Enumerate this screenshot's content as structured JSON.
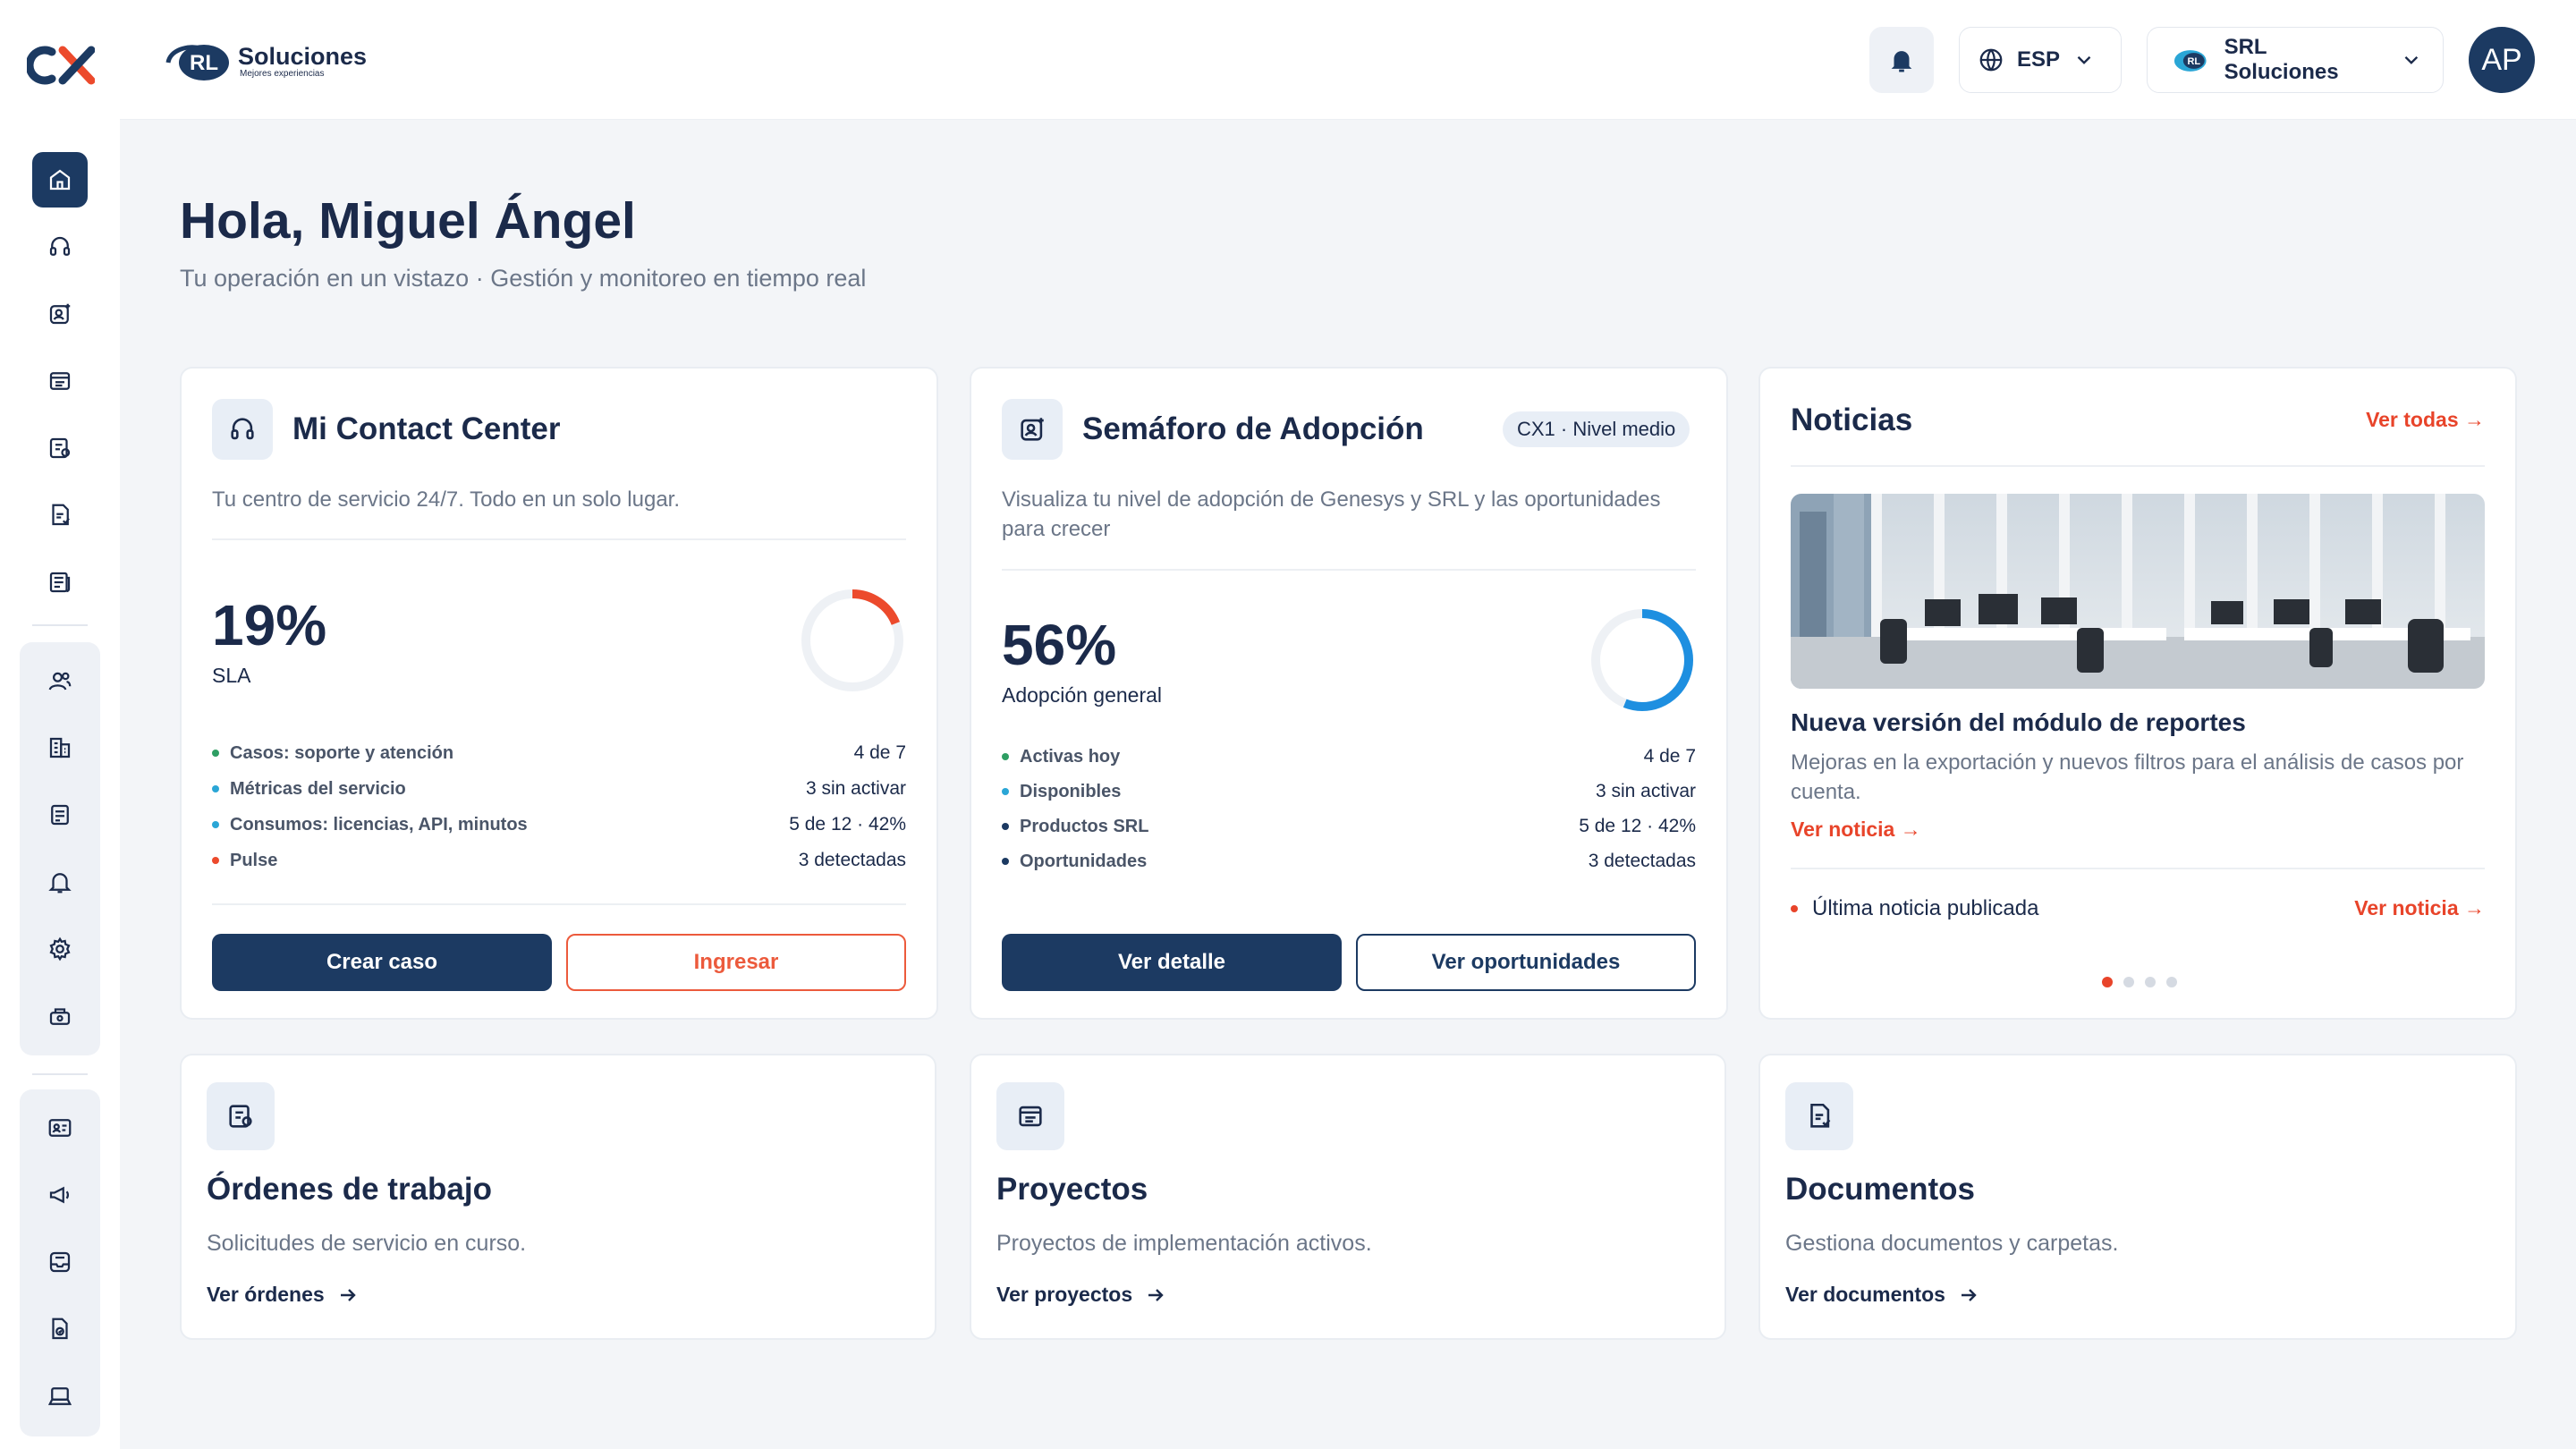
{
  "header": {
    "brand_name": "Soluciones",
    "brand_tag": "Mejores experiencias",
    "language": "ESP",
    "organization": "SRL Soluciones",
    "avatar_initials": "AP"
  },
  "greeting": {
    "title": "Hola, Miguel Ángel",
    "subtitle": "Tu operación en un vistazo · Gestión y monitoreo en tiempo real"
  },
  "contact_center": {
    "title": "Mi Contact Center",
    "description": "Tu centro de servicio 24/7. Todo en un solo lugar.",
    "big_value": "19%",
    "big_label": "SLA",
    "gauge_fraction": 0.19,
    "gauge_color": "#ec4a2c",
    "metrics": [
      {
        "label": "Casos: soporte y atención",
        "value": "4 de 7",
        "color": "#2e9e63"
      },
      {
        "label": "Métricas del servicio",
        "value": "3 sin activar",
        "color": "#2aa6d6"
      },
      {
        "label": "Consumos: licencias, API, minutos",
        "value": "5 de 12 · 42%",
        "color": "#2aa6d6"
      },
      {
        "label": "Pulse",
        "value": "3 detectadas",
        "color": "#ec4a2c"
      }
    ],
    "primary_button": "Crear caso",
    "secondary_button": "Ingresar"
  },
  "adoption": {
    "title": "Semáforo de Adopción",
    "badge": "CX1 · Nivel medio",
    "description": "Visualiza tu nivel de adopción de Genesys y SRL y las oportunidades para crecer",
    "big_value": "56%",
    "big_label": "Adopción general",
    "gauge_fraction": 0.56,
    "gauge_color": "#1e8fe0",
    "metrics": [
      {
        "label": "Activas hoy",
        "value": "4 de 7",
        "color": "#2e9e63"
      },
      {
        "label": "Disponibles",
        "value": "3 sin activar",
        "color": "#2aa6d6"
      },
      {
        "label": "Productos SRL",
        "value": "5 de 12 · 42%",
        "color": "#1c3a62"
      },
      {
        "label": "Oportunidades",
        "value": "3 detectadas",
        "color": "#1c3a62"
      }
    ],
    "primary_button": "Ver detalle",
    "secondary_button": "Ver oportunidades"
  },
  "news": {
    "title": "Noticias",
    "see_all": "Ver todas →",
    "headline": "Nueva versión del módulo de reportes",
    "summary": "Mejoras en la exportación y nuevos filtros para el análisis de casos por cuenta.",
    "read_link": "Ver noticia →",
    "latest_label": "Última noticia publicada",
    "latest_link": "Ver noticia →",
    "active_page": 0,
    "page_count": 4
  },
  "work_orders": {
    "title": "Órdenes de trabajo",
    "description": "Solicitudes de servicio en curso.",
    "link": "Ver órdenes"
  },
  "projects": {
    "title": "Proyectos",
    "description": "Proyectos de implementación activos.",
    "link": "Ver proyectos"
  },
  "documents": {
    "title": "Documentos",
    "description": "Gestiona documentos y carpetas.",
    "link": "Ver documentos"
  }
}
